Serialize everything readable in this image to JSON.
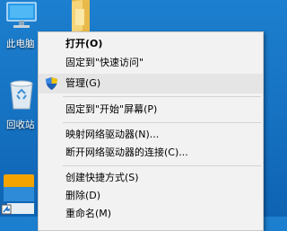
{
  "desktop": {
    "icons": [
      {
        "label": "此电脑",
        "icon": "this-pc-icon"
      },
      {
        "label": "回收站",
        "icon": "recycle-bin-icon"
      },
      {
        "label": "",
        "icon": "folder-icon"
      },
      {
        "label": "",
        "icon": "app-shortcut-icon"
      }
    ]
  },
  "context_menu": {
    "items": [
      {
        "label": "打开(O)",
        "bold": true
      },
      {
        "label": "固定到\"快速访问\""
      },
      {
        "label": "管理(G)",
        "icon": "uac-shield-icon",
        "highlighted": true
      },
      {
        "label": "固定到\"开始\"屏幕(P)"
      },
      {
        "label": "映射网络驱动器(N)..."
      },
      {
        "label": "断开网络驱动器的连接(C)..."
      },
      {
        "label": "创建快捷方式(S)"
      },
      {
        "label": "删除(D)"
      },
      {
        "label": "重命名(M)"
      }
    ]
  },
  "colors": {
    "desktop_bg": "#1774c4",
    "menu_bg": "#f2f2f2",
    "menu_hover": "#e5e5e5"
  }
}
